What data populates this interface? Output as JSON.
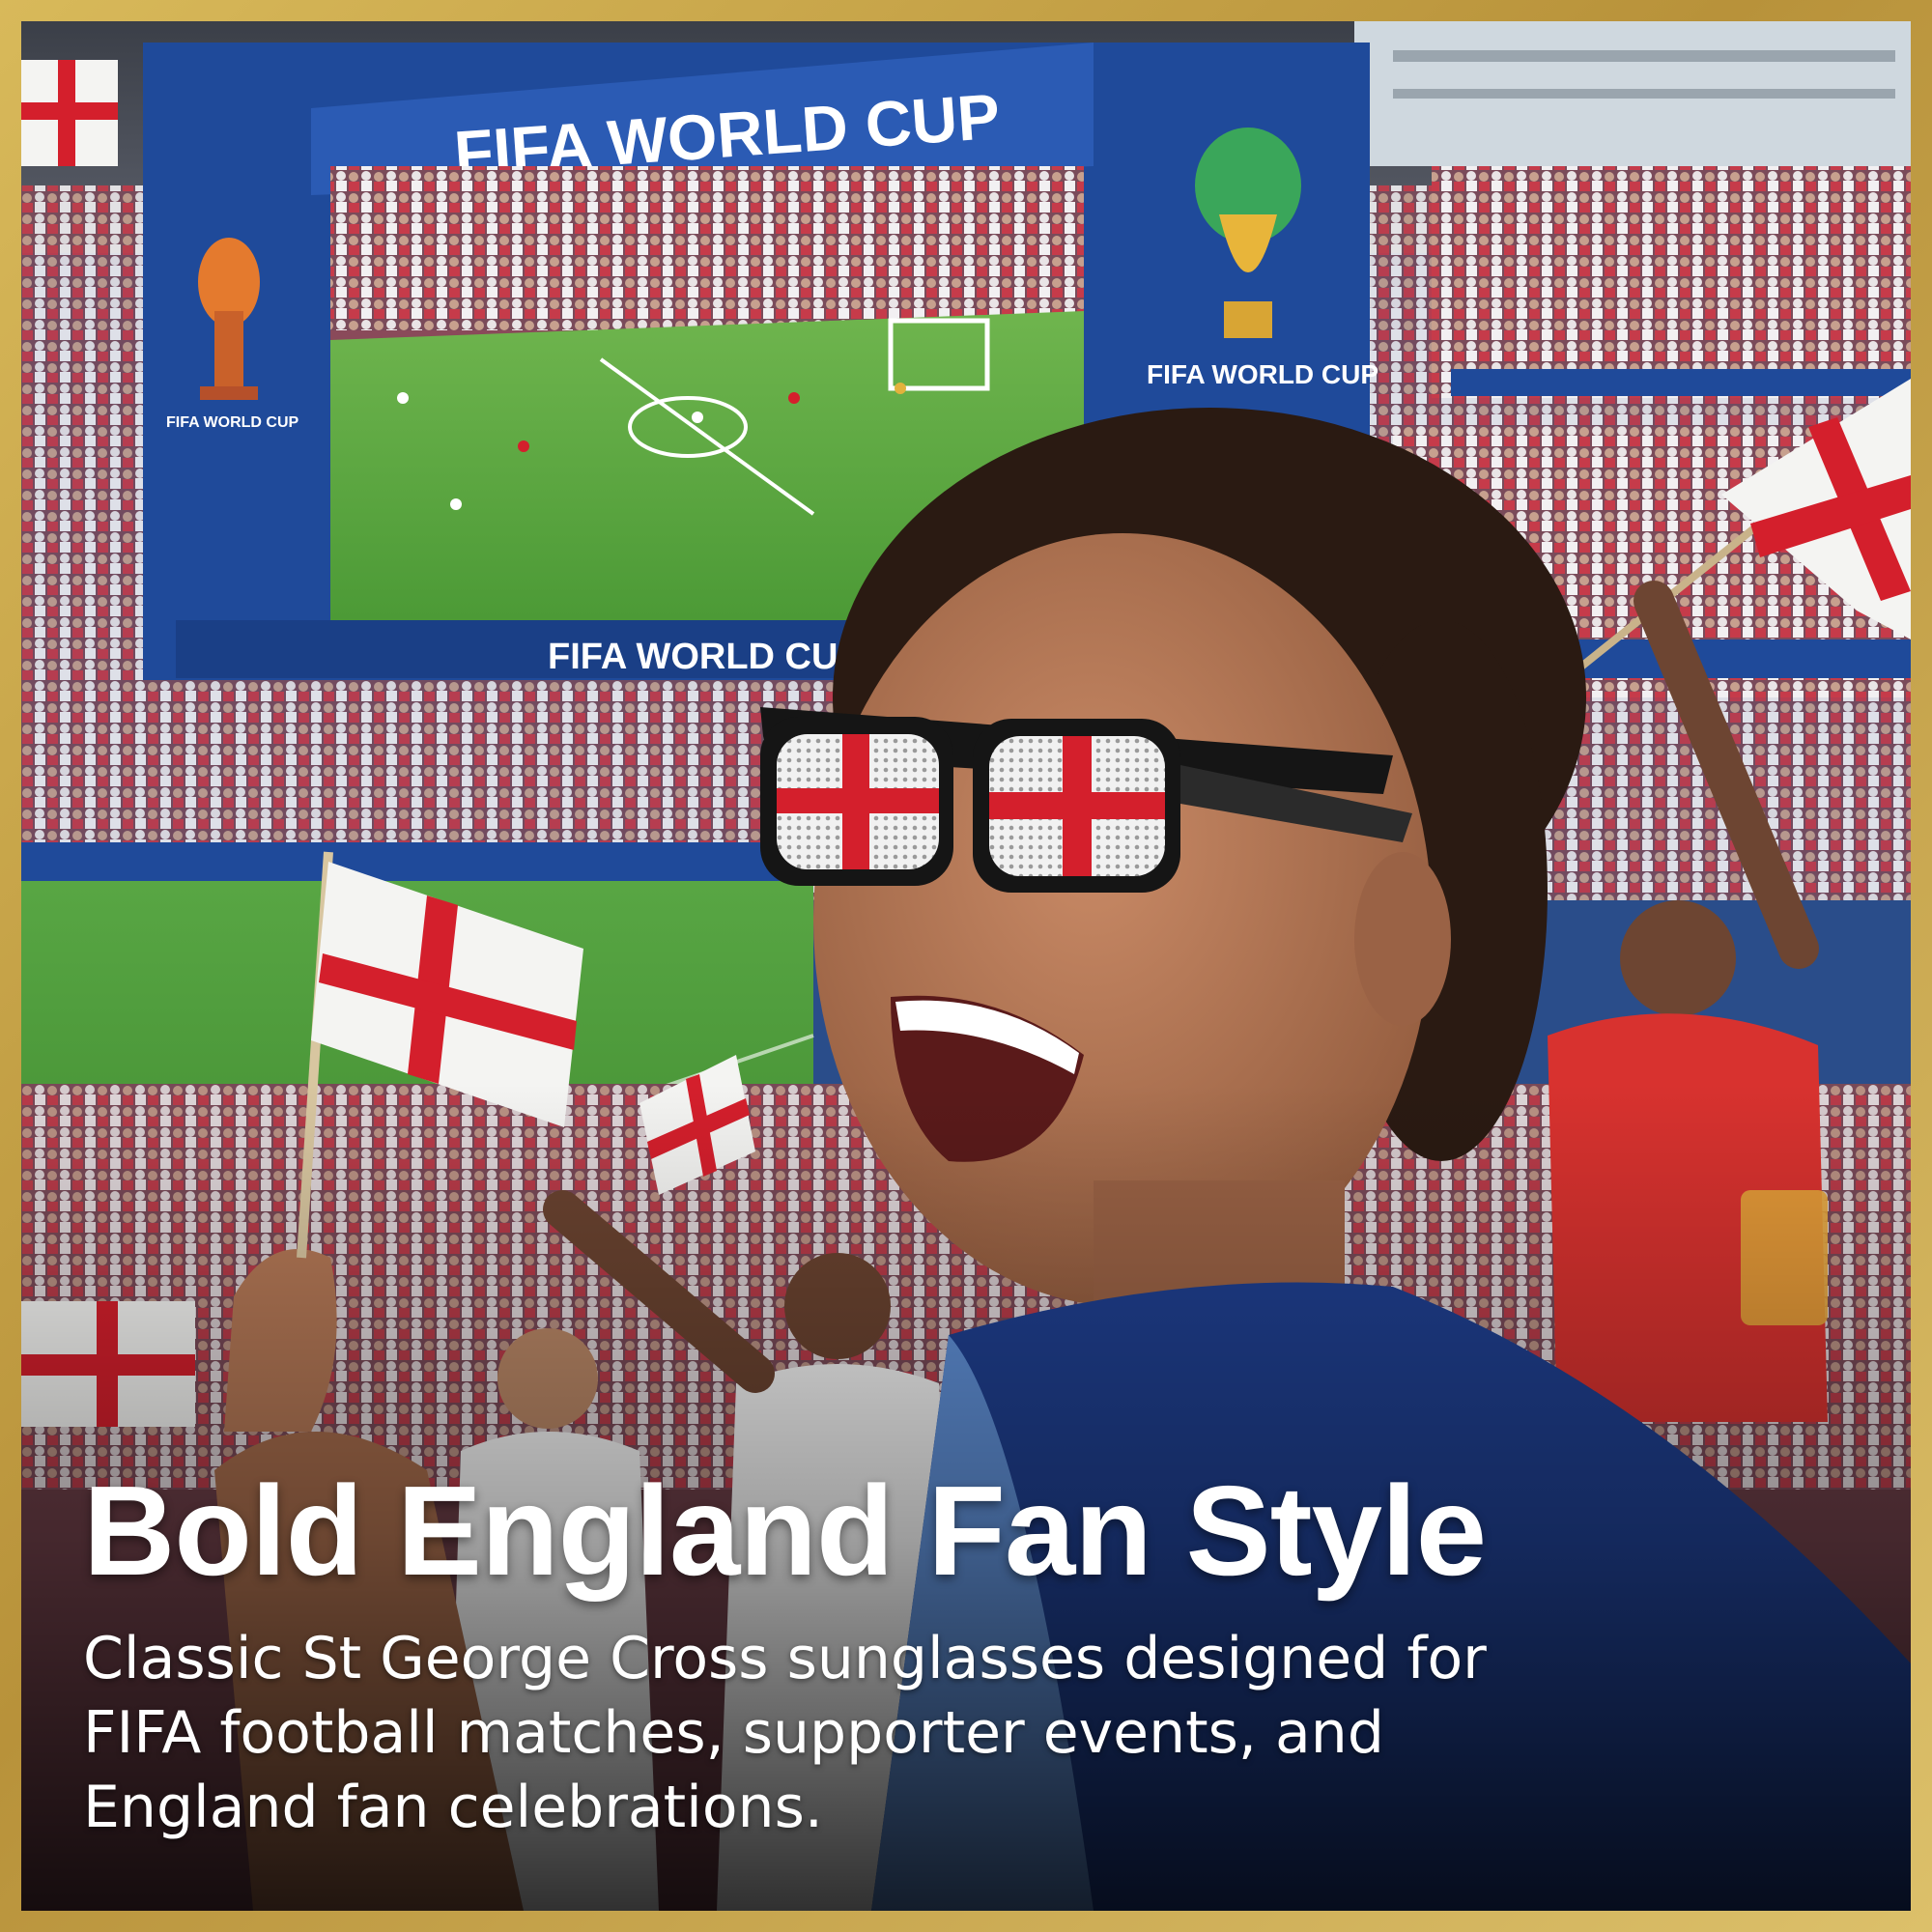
{
  "headline": "Bold England Fan Style",
  "subtext": "Classic St George Cross sunglasses designed for FIFA football matches, supporter events, and England fan celebrations.",
  "scene": {
    "screen_banner_top": "FIFA WORLD CUP",
    "screen_banner_bottom": "FIFA WORLD CUP",
    "right_panel_label": "FIFA WORLD CUP",
    "left_panel_label": "FIFA WORLD CUP"
  },
  "colors": {
    "frame_gold": "#c9a64c",
    "england_red": "#d41f2c",
    "flag_white": "#f4f4f2",
    "banner_blue": "#1f4a9a",
    "pitch_green": "#4f9a3a"
  }
}
